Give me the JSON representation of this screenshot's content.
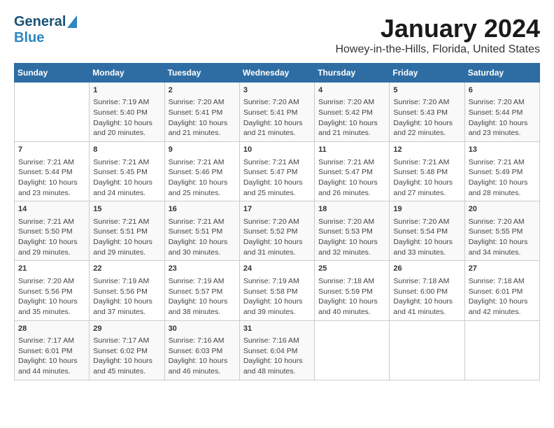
{
  "logo": {
    "general": "General",
    "blue": "Blue"
  },
  "title": "January 2024",
  "subtitle": "Howey-in-the-Hills, Florida, United States",
  "weekdays": [
    "Sunday",
    "Monday",
    "Tuesday",
    "Wednesday",
    "Thursday",
    "Friday",
    "Saturday"
  ],
  "weeks": [
    [
      {
        "day": "",
        "info": ""
      },
      {
        "day": "1",
        "info": "Sunrise: 7:19 AM\nSunset: 5:40 PM\nDaylight: 10 hours\nand 20 minutes."
      },
      {
        "day": "2",
        "info": "Sunrise: 7:20 AM\nSunset: 5:41 PM\nDaylight: 10 hours\nand 21 minutes."
      },
      {
        "day": "3",
        "info": "Sunrise: 7:20 AM\nSunset: 5:41 PM\nDaylight: 10 hours\nand 21 minutes."
      },
      {
        "day": "4",
        "info": "Sunrise: 7:20 AM\nSunset: 5:42 PM\nDaylight: 10 hours\nand 21 minutes."
      },
      {
        "day": "5",
        "info": "Sunrise: 7:20 AM\nSunset: 5:43 PM\nDaylight: 10 hours\nand 22 minutes."
      },
      {
        "day": "6",
        "info": "Sunrise: 7:20 AM\nSunset: 5:44 PM\nDaylight: 10 hours\nand 23 minutes."
      }
    ],
    [
      {
        "day": "7",
        "info": "Sunrise: 7:21 AM\nSunset: 5:44 PM\nDaylight: 10 hours\nand 23 minutes."
      },
      {
        "day": "8",
        "info": "Sunrise: 7:21 AM\nSunset: 5:45 PM\nDaylight: 10 hours\nand 24 minutes."
      },
      {
        "day": "9",
        "info": "Sunrise: 7:21 AM\nSunset: 5:46 PM\nDaylight: 10 hours\nand 25 minutes."
      },
      {
        "day": "10",
        "info": "Sunrise: 7:21 AM\nSunset: 5:47 PM\nDaylight: 10 hours\nand 25 minutes."
      },
      {
        "day": "11",
        "info": "Sunrise: 7:21 AM\nSunset: 5:47 PM\nDaylight: 10 hours\nand 26 minutes."
      },
      {
        "day": "12",
        "info": "Sunrise: 7:21 AM\nSunset: 5:48 PM\nDaylight: 10 hours\nand 27 minutes."
      },
      {
        "day": "13",
        "info": "Sunrise: 7:21 AM\nSunset: 5:49 PM\nDaylight: 10 hours\nand 28 minutes."
      }
    ],
    [
      {
        "day": "14",
        "info": "Sunrise: 7:21 AM\nSunset: 5:50 PM\nDaylight: 10 hours\nand 29 minutes."
      },
      {
        "day": "15",
        "info": "Sunrise: 7:21 AM\nSunset: 5:51 PM\nDaylight: 10 hours\nand 29 minutes."
      },
      {
        "day": "16",
        "info": "Sunrise: 7:21 AM\nSunset: 5:51 PM\nDaylight: 10 hours\nand 30 minutes."
      },
      {
        "day": "17",
        "info": "Sunrise: 7:20 AM\nSunset: 5:52 PM\nDaylight: 10 hours\nand 31 minutes."
      },
      {
        "day": "18",
        "info": "Sunrise: 7:20 AM\nSunset: 5:53 PM\nDaylight: 10 hours\nand 32 minutes."
      },
      {
        "day": "19",
        "info": "Sunrise: 7:20 AM\nSunset: 5:54 PM\nDaylight: 10 hours\nand 33 minutes."
      },
      {
        "day": "20",
        "info": "Sunrise: 7:20 AM\nSunset: 5:55 PM\nDaylight: 10 hours\nand 34 minutes."
      }
    ],
    [
      {
        "day": "21",
        "info": "Sunrise: 7:20 AM\nSunset: 5:56 PM\nDaylight: 10 hours\nand 35 minutes."
      },
      {
        "day": "22",
        "info": "Sunrise: 7:19 AM\nSunset: 5:56 PM\nDaylight: 10 hours\nand 37 minutes."
      },
      {
        "day": "23",
        "info": "Sunrise: 7:19 AM\nSunset: 5:57 PM\nDaylight: 10 hours\nand 38 minutes."
      },
      {
        "day": "24",
        "info": "Sunrise: 7:19 AM\nSunset: 5:58 PM\nDaylight: 10 hours\nand 39 minutes."
      },
      {
        "day": "25",
        "info": "Sunrise: 7:18 AM\nSunset: 5:59 PM\nDaylight: 10 hours\nand 40 minutes."
      },
      {
        "day": "26",
        "info": "Sunrise: 7:18 AM\nSunset: 6:00 PM\nDaylight: 10 hours\nand 41 minutes."
      },
      {
        "day": "27",
        "info": "Sunrise: 7:18 AM\nSunset: 6:01 PM\nDaylight: 10 hours\nand 42 minutes."
      }
    ],
    [
      {
        "day": "28",
        "info": "Sunrise: 7:17 AM\nSunset: 6:01 PM\nDaylight: 10 hours\nand 44 minutes."
      },
      {
        "day": "29",
        "info": "Sunrise: 7:17 AM\nSunset: 6:02 PM\nDaylight: 10 hours\nand 45 minutes."
      },
      {
        "day": "30",
        "info": "Sunrise: 7:16 AM\nSunset: 6:03 PM\nDaylight: 10 hours\nand 46 minutes."
      },
      {
        "day": "31",
        "info": "Sunrise: 7:16 AM\nSunset: 6:04 PM\nDaylight: 10 hours\nand 48 minutes."
      },
      {
        "day": "",
        "info": ""
      },
      {
        "day": "",
        "info": ""
      },
      {
        "day": "",
        "info": ""
      }
    ]
  ]
}
